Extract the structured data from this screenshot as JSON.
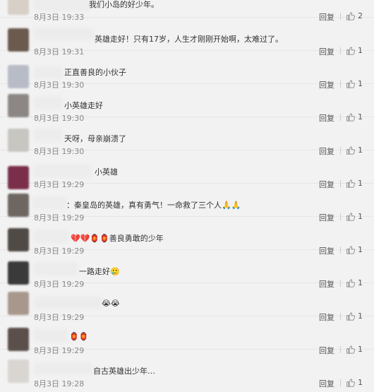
{
  "comments": [
    {
      "text": "我们小岛的好少年。",
      "time": "8月3日 19:33",
      "reply": "回复",
      "likes": "2",
      "avatar_color": "#d8d0c7"
    },
    {
      "text": "英雄走好！只有17岁，人生才刚刚开始啊，太难过了。",
      "time": "8月3日 19:31",
      "reply": "回复",
      "likes": "1",
      "avatar_color": "#6b5a4e"
    },
    {
      "text": "正直善良的小伙子",
      "time": "8月3日 19:30",
      "reply": "回复",
      "likes": "1",
      "avatar_color": "#b8bcc6"
    },
    {
      "text": "小英雄走好",
      "time": "8月3日 19:30",
      "reply": "回复",
      "likes": "1",
      "avatar_color": "#8c8784"
    },
    {
      "text": "天呀，母亲崩溃了",
      "time": "8月3日 19:30",
      "reply": "回复",
      "likes": "1",
      "avatar_color": "#c8c6c0"
    },
    {
      "text": "小英雄",
      "time": "8月3日 19:29",
      "reply": "回复",
      "likes": "1",
      "avatar_color": "#7a2e4a"
    },
    {
      "text": "：秦皇岛的英雄，真有勇气！一命救了三个人🙏🙏",
      "time": "8月3日 19:29",
      "reply": "回复",
      "likes": "1",
      "avatar_color": "#6d6661"
    },
    {
      "text": "💔💔🏮🏮善良勇敢的少年",
      "time": "8月3日 19:29",
      "reply": "回复",
      "likes": "1",
      "avatar_color": "#4f4a45"
    },
    {
      "text": "一路走好🥲",
      "time": "8月3日 19:29",
      "reply": "回复",
      "likes": "1",
      "avatar_color": "#3a3a3a"
    },
    {
      "text": "😭😭",
      "time": "8月3日 19:29",
      "reply": "回复",
      "likes": "1",
      "avatar_color": "#a8978c"
    },
    {
      "text": "🏮🏮",
      "time": "8月3日 19:29",
      "reply": "回复",
      "likes": "1",
      "avatar_color": "#5a4f4a"
    },
    {
      "text": "自古英雄出少年…",
      "time": "8月3日 19:28",
      "reply": "回复",
      "likes": "1",
      "avatar_color": "#d9d5d0"
    }
  ]
}
